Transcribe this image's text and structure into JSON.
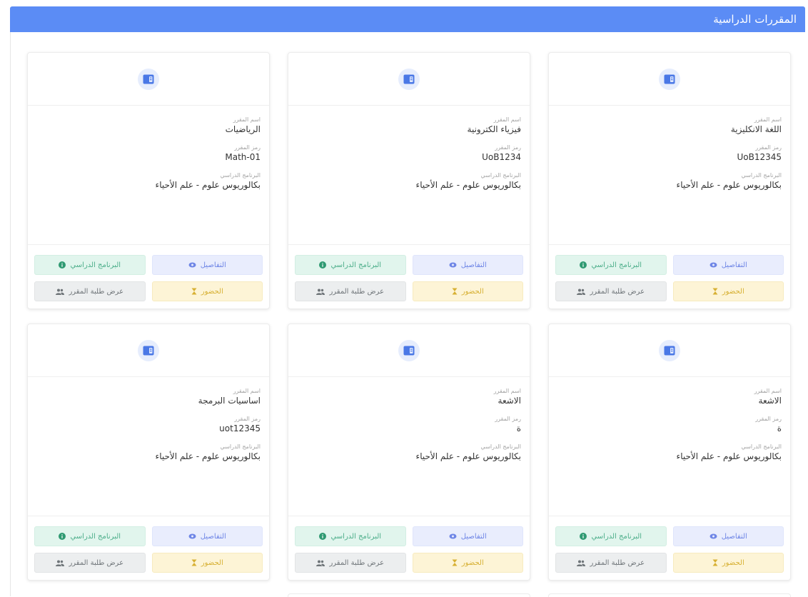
{
  "header": {
    "title": "المقررات الدراسية"
  },
  "labels": {
    "course_name": "اسم المقرر",
    "course_code": "رمز المقرر",
    "program": "البرنامج الدراسي"
  },
  "buttons": {
    "details": "التفاصيل",
    "program": "البرنامج الدراسي",
    "attendance": "الحضور",
    "students": "عرض طلبة المقرر"
  },
  "icons": {
    "course": "course-book-icon",
    "details": "eye-icon",
    "program": "info-circle-icon",
    "attendance": "hourglass-icon",
    "students": "users-icon"
  },
  "colors": {
    "header_bg": "#5b8cf5",
    "details": "#6f86e6",
    "program": "#4cae8a",
    "attendance": "#d7b033",
    "students": "#6f7579"
  },
  "courses": [
    {
      "name": "اللغة الانكليزية",
      "code": "UoB12345",
      "program": "بكالوريوس علوم - علم الأحياء"
    },
    {
      "name": "فيزياء الكترونية",
      "code": "UoB1234",
      "program": "بكالوريوس علوم - علم الأحياء"
    },
    {
      "name": "الرياضيات",
      "code": "Math-01",
      "program": "بكالوريوس علوم - علم الأحياء"
    },
    {
      "name": "الاشعة",
      "code": "ة",
      "program": "بكالوريوس علوم - علم الأحياء"
    },
    {
      "name": "الاشعة",
      "code": "ة",
      "program": "بكالوريوس علوم - علم الأحياء"
    },
    {
      "name": "اساسيات البرمجة",
      "code": "uot12345",
      "program": "بكالوريوس علوم - علم الأحياء"
    }
  ]
}
